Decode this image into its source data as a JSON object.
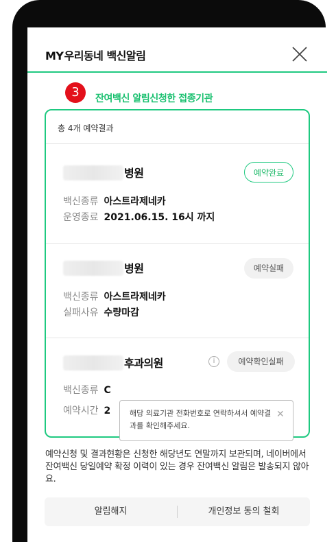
{
  "header": {
    "brand_my": "MY",
    "brand_rest": "우리동네 백신알림"
  },
  "step": {
    "number": "3",
    "title": "잔여백신 알림신청한 접종기관"
  },
  "card": {
    "count_text": "총 4개 예약결과",
    "items": [
      {
        "name": "병원",
        "status": "예약완료",
        "rows": [
          {
            "label": "백신종류",
            "value": "아스트라제네카"
          },
          {
            "label": "운영종료",
            "value": "2021.06.15. 16시 까지"
          }
        ]
      },
      {
        "name": "병원",
        "status": "예약실패",
        "rows": [
          {
            "label": "백신종류",
            "value": "아스트라제네카"
          },
          {
            "label": "실패사유",
            "value": "수량마감"
          }
        ]
      },
      {
        "name": "후과의원",
        "status": "예약확인실패",
        "info_icon": "i",
        "rows": [
          {
            "label": "백신종류",
            "value": "C"
          },
          {
            "label": "예약시간",
            "value": "2"
          }
        ]
      }
    ],
    "tooltip": {
      "text": "해당 의료기관 전화번호로 연락하셔서 예약결과를 확인해주세요.",
      "close": "✕"
    }
  },
  "notice": "예약신청 및 결과현황은 신청한 해당년도 연말까지 보관되며, 네이버에서 잔여백신 당일예약 확정 이력이 있는 경우 잔여백신 알림은 발송되지 않아요.",
  "actions": {
    "unsubscribe": "알림해지",
    "withdraw_consent": "개인정보 동의 철회"
  },
  "colors": {
    "accent": "#1ec980",
    "step_badge": "#e3101b"
  }
}
